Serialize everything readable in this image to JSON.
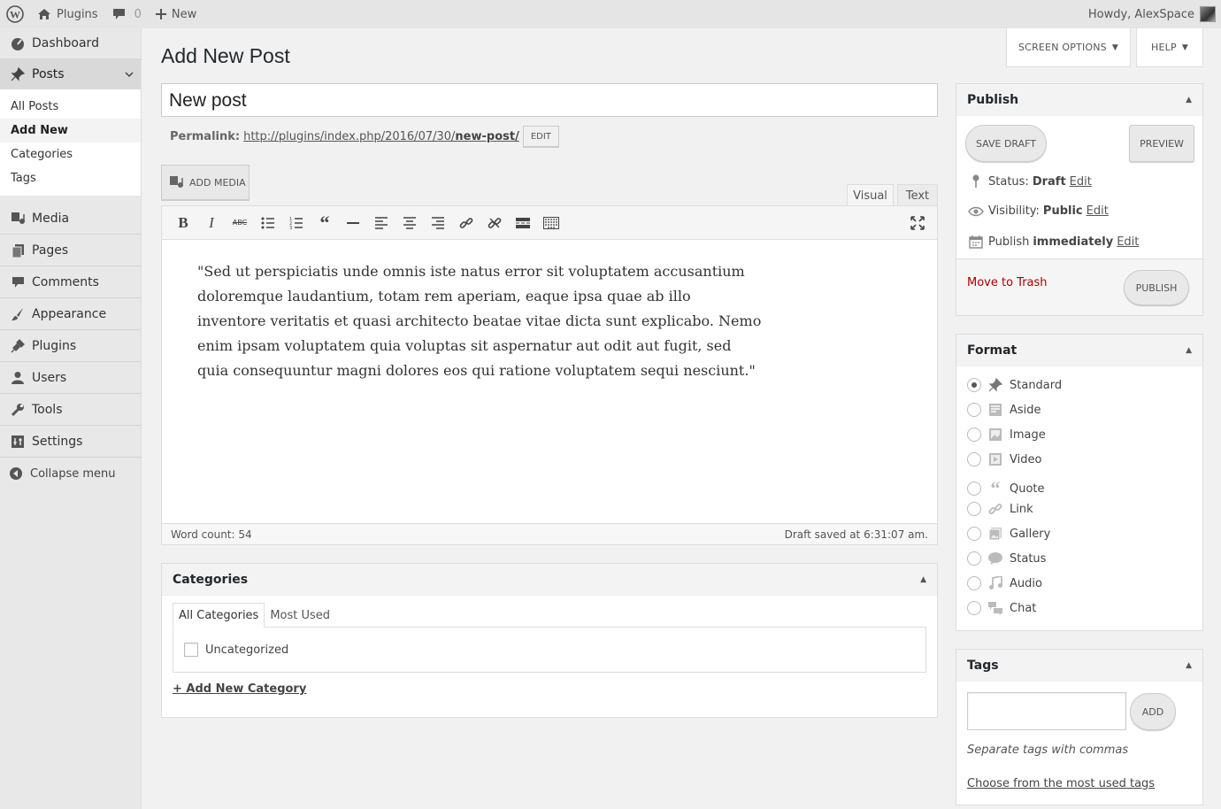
{
  "adminbar": {
    "site_name": "Plugins",
    "comments_count": "0",
    "new_label": "New",
    "howdy": "Howdy, AlexSpace"
  },
  "sidebar": {
    "items": [
      {
        "label": "Dashboard",
        "icon": "dashboard-icon"
      },
      {
        "label": "Posts",
        "icon": "pin-icon"
      },
      {
        "label": "Media",
        "icon": "media-icon"
      },
      {
        "label": "Pages",
        "icon": "pages-icon"
      },
      {
        "label": "Comments",
        "icon": "comment-icon"
      },
      {
        "label": "Appearance",
        "icon": "brush-icon"
      },
      {
        "label": "Plugins",
        "icon": "plugin-icon"
      },
      {
        "label": "Users",
        "icon": "user-icon"
      },
      {
        "label": "Tools",
        "icon": "wrench-icon"
      },
      {
        "label": "Settings",
        "icon": "settings-icon"
      }
    ],
    "submenu": [
      "All Posts",
      "Add New",
      "Categories",
      "Tags"
    ],
    "collapse": "Collapse menu"
  },
  "header": {
    "title": "Add New Post",
    "screen_options": "SCREEN OPTIONS",
    "help": "HELP"
  },
  "post": {
    "title": "New post",
    "permalink_label": "Permalink:",
    "permalink_base": "http://plugins/index.php/2016/07/30/",
    "permalink_slug": "new-post/",
    "edit_btn": "EDIT"
  },
  "editor": {
    "add_media": "ADD MEDIA",
    "tab_visual": "Visual",
    "tab_text": "Text",
    "content": "\"Sed ut perspiciatis unde omnis iste natus error sit voluptatem accusantium doloremque laudantium, totam rem aperiam, eaque ipsa quae ab illo inventore veritatis et quasi architecto beatae vitae dicta sunt explicabo. Nemo enim ipsam voluptatem quia voluptas sit aspernatur aut odit aut fugit, sed quia consequuntur magni dolores eos qui ratione voluptatem sequi nesciunt.\"",
    "word_count": "Word count: 54",
    "draft_saved": "Draft saved at 6:31:07 am."
  },
  "categories": {
    "title": "Categories",
    "tab_all": "All Categories",
    "tab_most": "Most Used",
    "items": [
      "Uncategorized"
    ],
    "add_new": "+ Add New Category"
  },
  "publish": {
    "title": "Publish",
    "save_draft": "SAVE DRAFT",
    "preview": "PREVIEW",
    "status_label": "Status:",
    "status_value": "Draft",
    "visibility_label": "Visibility:",
    "visibility_value": "Public",
    "publish_label": "Publish",
    "publish_value": "immediately",
    "edit": "Edit",
    "trash": "Move to Trash",
    "publish_btn": "PUBLISH"
  },
  "format": {
    "title": "Format",
    "selected": "Standard",
    "options": [
      "Standard",
      "Aside",
      "Image",
      "Video",
      "Quote",
      "Link",
      "Gallery",
      "Status",
      "Audio",
      "Chat"
    ]
  },
  "tags": {
    "title": "Tags",
    "add_btn": "ADD",
    "hint": "Separate tags with commas",
    "choose": "Choose from the most used tags"
  }
}
